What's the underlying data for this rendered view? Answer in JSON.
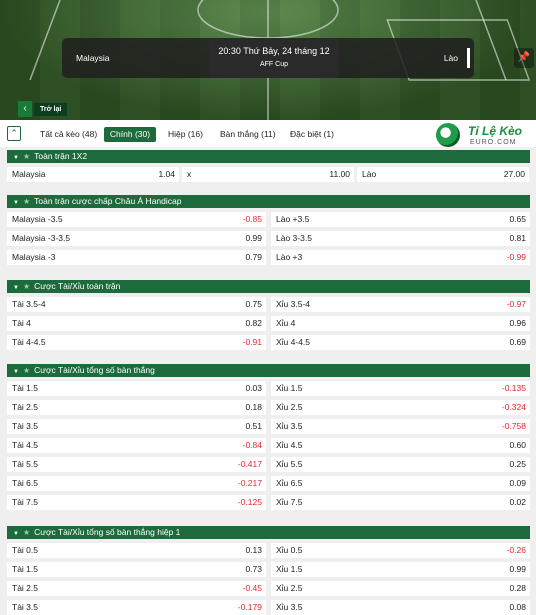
{
  "match": {
    "home": "Malaysia",
    "away": "Lào",
    "datetime": "20:30 Thứ Bảy, 24 tháng 12",
    "league": "AFF Cup",
    "back_label": "Trở lại"
  },
  "tabs": [
    {
      "label": "Tất cả kèo (48)",
      "active": false
    },
    {
      "label": "Chính (30)",
      "active": true
    },
    {
      "label": "Hiệp (16)",
      "active": false
    },
    {
      "label": "Bàn thắng (11)",
      "active": false
    },
    {
      "label": "Đặc biệt (1)",
      "active": false
    }
  ],
  "logo": {
    "title": "Tỉ Lệ Kèo",
    "subtitle": "EURO.COM"
  },
  "sections": {
    "s1": {
      "title": "Toàn trận 1X2",
      "row": [
        {
          "label": "Malaysia",
          "odd": "1.04"
        },
        {
          "label": "x",
          "odd": "11.00"
        },
        {
          "label": "Lào",
          "odd": "27.00"
        }
      ]
    },
    "s2": {
      "title": "Toàn trận cược chấp Châu Á Handicap",
      "rows": [
        [
          {
            "label": "Malaysia -3.5",
            "odd": "-0.85"
          },
          {
            "label": "Lào +3.5",
            "odd": "0.65"
          }
        ],
        [
          {
            "label": "Malaysia -3-3.5",
            "odd": "0.99"
          },
          {
            "label": "Lào 3-3.5",
            "odd": "0.81"
          }
        ],
        [
          {
            "label": "Malaysia -3",
            "odd": "0.79"
          },
          {
            "label": "Lào +3",
            "odd": "-0.99"
          }
        ]
      ]
    },
    "s3": {
      "title": "Cược Tài/Xỉu toàn trận",
      "rows": [
        [
          {
            "label": "Tài 3.5-4",
            "odd": "0.75"
          },
          {
            "label": "Xỉu 3.5-4",
            "odd": "-0.97"
          }
        ],
        [
          {
            "label": "Tài 4",
            "odd": "0.82"
          },
          {
            "label": "Xỉu 4",
            "odd": "0.96"
          }
        ],
        [
          {
            "label": "Tài 4-4.5",
            "odd": "-0.91"
          },
          {
            "label": "Xỉu 4-4.5",
            "odd": "0.69"
          }
        ]
      ]
    },
    "s4": {
      "title": "Cược Tài/Xỉu tổng số bàn thắng",
      "rows": [
        [
          {
            "label": "Tài 1.5",
            "odd": "0.03"
          },
          {
            "label": "Xỉu 1.5",
            "odd": "-0.135"
          }
        ],
        [
          {
            "label": "Tài 2.5",
            "odd": "0.18"
          },
          {
            "label": "Xỉu 2.5",
            "odd": "-0.324"
          }
        ],
        [
          {
            "label": "Tài 3.5",
            "odd": "0.51"
          },
          {
            "label": "Xỉu 3.5",
            "odd": "-0.758"
          }
        ],
        [
          {
            "label": "Tài 4.5",
            "odd": "-0.84"
          },
          {
            "label": "Xỉu 4.5",
            "odd": "0.60"
          }
        ],
        [
          {
            "label": "Tài 5.5",
            "odd": "-0.417"
          },
          {
            "label": "Xỉu 5.5",
            "odd": "0.25"
          }
        ],
        [
          {
            "label": "Tài 6.5",
            "odd": "-0.217"
          },
          {
            "label": "Xỉu 6.5",
            "odd": "0.09"
          }
        ],
        [
          {
            "label": "Tài 7.5",
            "odd": "-0.125"
          },
          {
            "label": "Xỉu 7.5",
            "odd": "0.02"
          }
        ]
      ]
    },
    "s5": {
      "title": "Cược Tài/Xỉu tổng số bàn thắng hiệp 1",
      "rows": [
        [
          {
            "label": "Tài 0.5",
            "odd": "0.13"
          },
          {
            "label": "Xỉu 0.5",
            "odd": "-0.26"
          }
        ],
        [
          {
            "label": "Tài 1.5",
            "odd": "0.73"
          },
          {
            "label": "Xỉu 1.5",
            "odd": "0.99"
          }
        ],
        [
          {
            "label": "Tài 2.5",
            "odd": "-0.45"
          },
          {
            "label": "Xỉu 2.5",
            "odd": "0.28"
          }
        ],
        [
          {
            "label": "Tài 3.5",
            "odd": "-0.179"
          },
          {
            "label": "Xỉu 3.5",
            "odd": "0.08"
          }
        ]
      ]
    }
  },
  "colors": {
    "header_green": "#1d6b3c",
    "negative": "#e8262e"
  }
}
